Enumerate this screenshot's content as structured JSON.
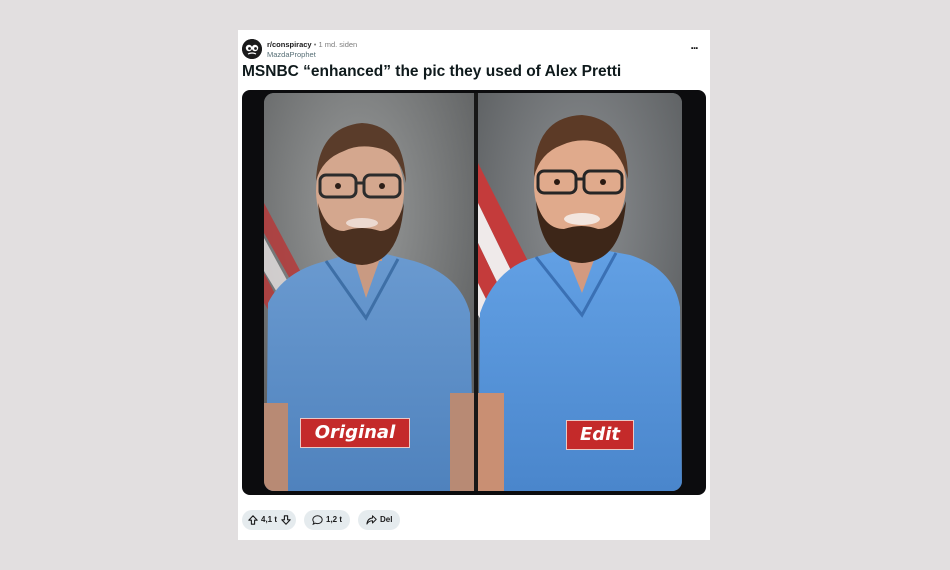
{
  "post": {
    "subreddit": "r/conspiracy",
    "separator": "•",
    "time": "1 md. siden",
    "author": "MazdaProphet",
    "more_label": "...",
    "title": "MSNBC “enhanced” the pic they used of Alex Pretti",
    "image": {
      "label_left": "Original",
      "label_right": "Edit"
    }
  },
  "actions": {
    "votes": "4,1 t",
    "comments": "1,2 t",
    "share": "Del"
  },
  "colors": {
    "background": "#e2dfe0",
    "tag_red": "#c42a2a",
    "scrubs_blue": "#5b93d0",
    "pill_bg": "#e5ebee"
  }
}
